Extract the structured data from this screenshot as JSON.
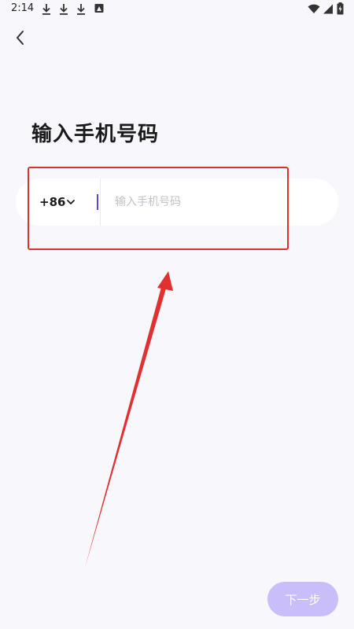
{
  "status_bar": {
    "time": "2:14",
    "icons": [
      "download-icon",
      "download-icon",
      "download-icon",
      "photo-notification-icon",
      "wifi-icon",
      "signal-icon",
      "battery-charging-icon"
    ]
  },
  "header": {
    "back_icon": "chevron-left-icon"
  },
  "page": {
    "title": "输入手机号码"
  },
  "phone_form": {
    "country_code": "+86",
    "dropdown_icon": "chevron-down-icon",
    "input_value": "",
    "input_placeholder": "输入手机号码"
  },
  "annotation": {
    "box_color": "#e03030",
    "arrow_color": "#e03030"
  },
  "footer": {
    "next_label": "下一步",
    "next_color": "#c9befa"
  }
}
